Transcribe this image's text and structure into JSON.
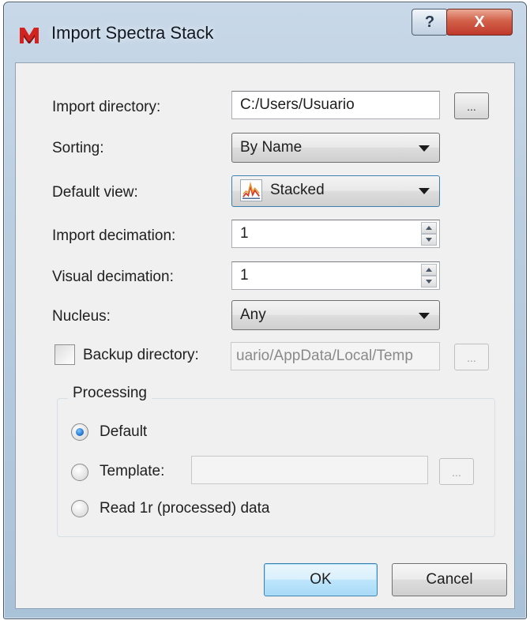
{
  "window": {
    "title": "Import Spectra Stack",
    "help_glyph": "?",
    "close_glyph": "X",
    "accent_color": "#c0392b",
    "app_icon": "mnova-logo-icon"
  },
  "form": {
    "import_directory": {
      "label": "Import directory:",
      "value": "C:/Users/Usuario",
      "browse_label": "..."
    },
    "sorting": {
      "label": "Sorting:",
      "value": "By Name"
    },
    "default_view": {
      "label": "Default view:",
      "value": "Stacked",
      "icon": "stacked-spectra-icon"
    },
    "import_decimation": {
      "label": "Import decimation:",
      "value": "1"
    },
    "visual_decimation": {
      "label": "Visual decimation:",
      "value": "1"
    },
    "nucleus": {
      "label": "Nucleus:",
      "value": "Any"
    },
    "backup_directory": {
      "label": "Backup directory:",
      "value": "uario/AppData/Local/Temp",
      "checked": false,
      "browse_label": "..."
    }
  },
  "processing": {
    "title": "Processing",
    "options": [
      {
        "label": "Default",
        "checked": true
      },
      {
        "label": "Template:",
        "checked": false
      },
      {
        "label": "Read 1r (processed) data",
        "checked": false
      }
    ],
    "template_value": "",
    "template_browse_label": "..."
  },
  "buttons": {
    "ok": "OK",
    "cancel": "Cancel"
  }
}
